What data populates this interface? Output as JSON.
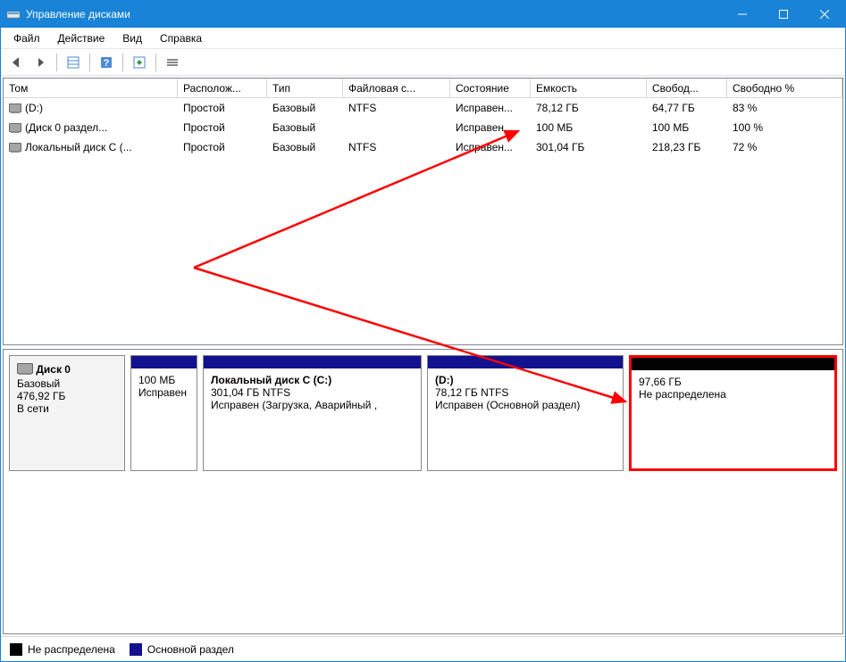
{
  "window": {
    "title": "Управление дисками"
  },
  "menu": {
    "file": "Файл",
    "action": "Действие",
    "view": "Вид",
    "help": "Справка"
  },
  "columns": {
    "volume": "Том",
    "layout": "Располож...",
    "type": "Тип",
    "fs": "Файловая с...",
    "status": "Состояние",
    "capacity": "Емкость",
    "free": "Свобод...",
    "freepct": "Свободно %"
  },
  "volumes": [
    {
      "name": "(D:)",
      "layout": "Простой",
      "type": "Базовый",
      "fs": "NTFS",
      "status": "Исправен...",
      "capacity": "78,12 ГБ",
      "free": "64,77 ГБ",
      "freepct": "83 %"
    },
    {
      "name": "(Диск 0 раздел...",
      "layout": "Простой",
      "type": "Базовый",
      "fs": "",
      "status": "Исправен...",
      "capacity": "100 МБ",
      "free": "100 МБ",
      "freepct": "100 %"
    },
    {
      "name": "Локальный диск C (...",
      "layout": "Простой",
      "type": "Базовый",
      "fs": "NTFS",
      "status": "Исправен...",
      "capacity": "301,04 ГБ",
      "free": "218,23 ГБ",
      "freepct": "72 %"
    }
  ],
  "disk": {
    "label": "Диск 0",
    "type": "Базовый",
    "size": "476,92 ГБ",
    "status": "В сети"
  },
  "partitions": [
    {
      "name": "",
      "line1": "100 МБ",
      "line2": "Исправен",
      "color": "primary"
    },
    {
      "name": "Локальный диск C  (C:)",
      "line1": "301,04 ГБ NTFS",
      "line2": "Исправен (Загрузка, Аварийный ,",
      "color": "primary"
    },
    {
      "name": "(D:)",
      "line1": "78,12 ГБ NTFS",
      "line2": "Исправен (Основной раздел)",
      "color": "primary"
    },
    {
      "name": "",
      "line1": "97,66 ГБ",
      "line2": "Не распределена",
      "color": "unalloc"
    }
  ],
  "legend": {
    "unalloc": "Не распределена",
    "primary": "Основной раздел"
  }
}
